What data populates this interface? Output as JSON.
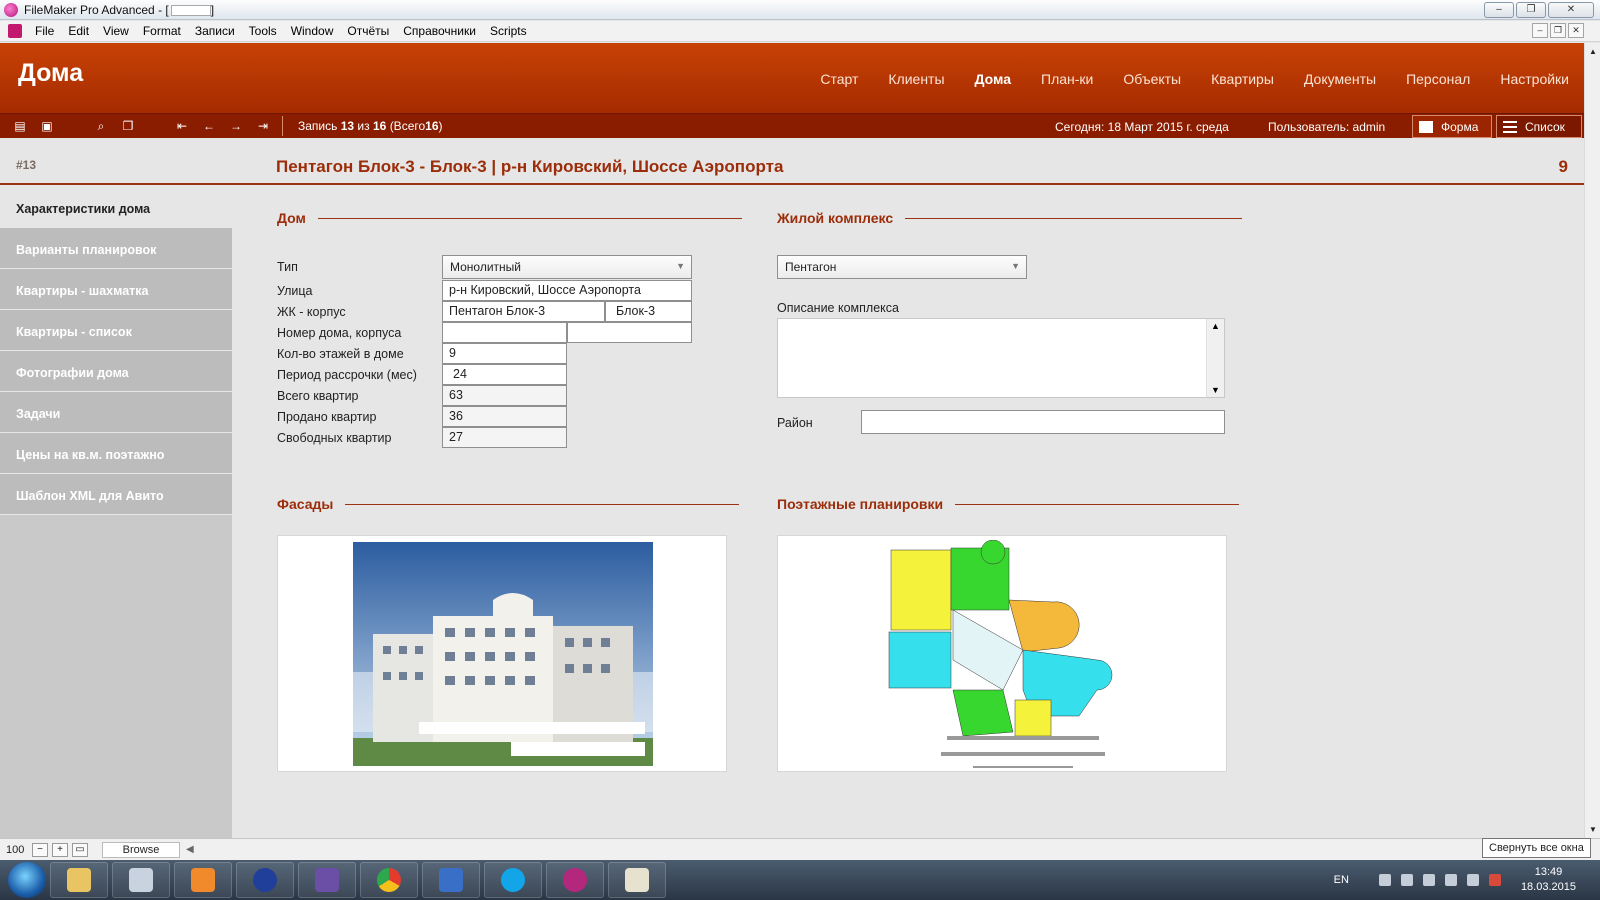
{
  "window": {
    "title": "FileMaker Pro Advanced - [",
    "title_tail": "]",
    "minimize": "–",
    "restore": "❐",
    "close": "✕"
  },
  "menu": [
    "File",
    "Edit",
    "View",
    "Format",
    "Записи",
    "Tools",
    "Window",
    "Отчёты",
    "Справочники",
    "Scripts"
  ],
  "app": {
    "module_title": "Дома",
    "nav": [
      "Старт",
      "Клиенты",
      "Дома",
      "План-ки",
      "Объекты",
      "Квартиры",
      "Документы",
      "Персонал",
      "Настройки"
    ],
    "nav_active": "Дома"
  },
  "toolbar": {
    "record_prefix": "Запись",
    "record_current": "13",
    "record_of": "из",
    "record_total": "16",
    "record_all_prefix": "(Всего",
    "record_all": "16",
    "record_all_suffix": ")",
    "today": "Сегодня: 18 Март 2015 г. среда",
    "user": "Пользователь: admin",
    "form_label": "Форма",
    "list_label": "Список"
  },
  "record": {
    "id": "#13",
    "title": "Пентагон Блок-3 - Блок-3 | р-н Кировский, Шоссе Аэропорта",
    "count": "9"
  },
  "sidebar": [
    "Характеристики дома",
    "Варианты планировок",
    "Квартиры - шахматка",
    "Квартиры - список",
    "Фотографии дома",
    "Задачи",
    "Цены на кв.м. поэтажно",
    "Шаблон XML для Авито"
  ],
  "house": {
    "section": "Дом",
    "labels": {
      "type": "Тип",
      "street": "Улица",
      "complex_block": "ЖК - корпус",
      "house_number": "Номер дома, корпуса",
      "floors": "Кол-во этажей в доме",
      "installment": "Период рассрочки (мес)",
      "total": "Всего квартир",
      "sold": "Продано квартир",
      "free": "Свободных квартир"
    },
    "values": {
      "type": "Монолитный",
      "street": "р-н Кировский, Шоссе Аэропорта",
      "complex": "Пентагон Блок-3",
      "block": "Блок-3",
      "number": "",
      "building": "",
      "floors": "9",
      "installment": "24",
      "total": "63",
      "sold": "36",
      "free": "27"
    }
  },
  "complex": {
    "section": "Жилой комплекс",
    "selected": "Пентагон",
    "description_label": "Описание комплекса",
    "district_label": "Район",
    "district_value": ""
  },
  "facades": {
    "section": "Фасады"
  },
  "floorplans": {
    "section": "Поэтажные планировки"
  },
  "statusbar": {
    "zoom": "100",
    "mode": "Browse",
    "tooltip": "Свернуть все окна"
  },
  "tray": {
    "lang": "EN",
    "time": "13:49",
    "date": "18.03.2015"
  },
  "colors": {
    "header_red": "#b63606",
    "toolbar_dark": "#8a1c00",
    "accent_text": "#9b2d0a"
  }
}
